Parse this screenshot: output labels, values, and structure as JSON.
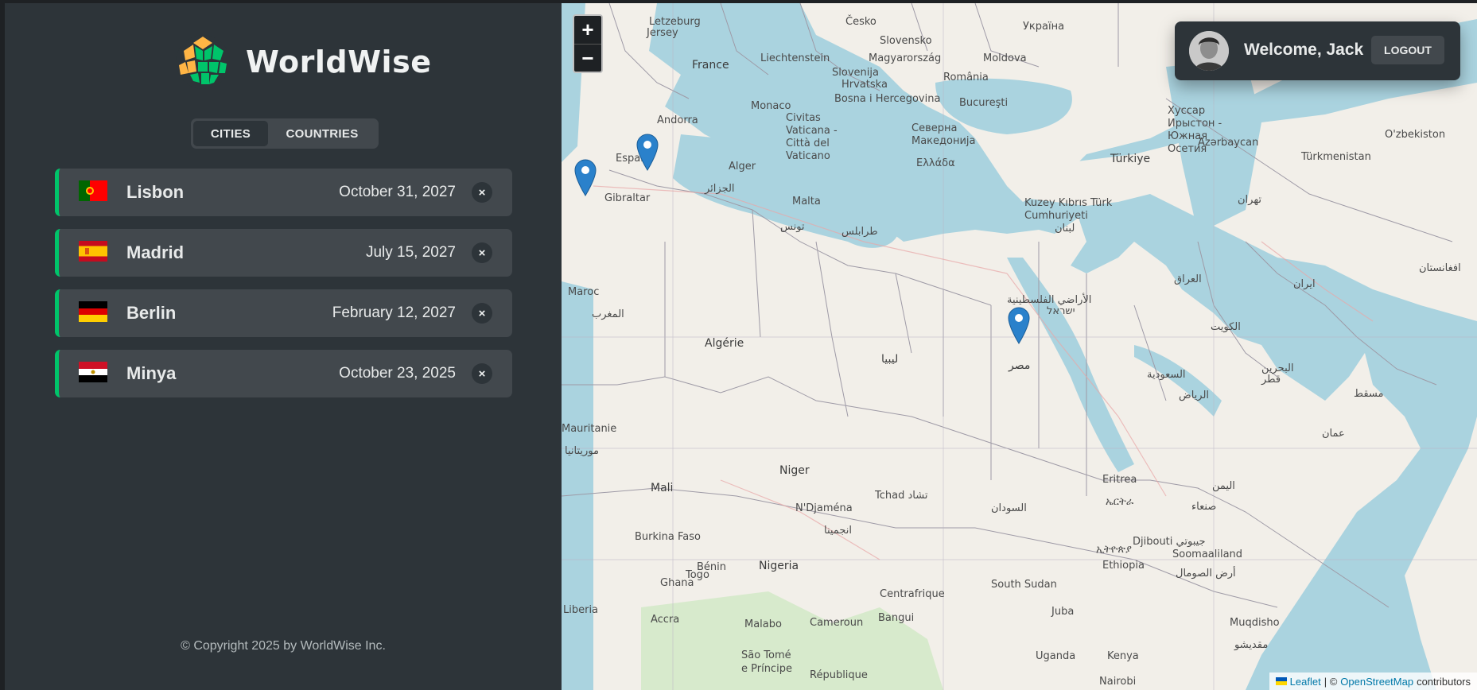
{
  "app": {
    "name": "WorldWise"
  },
  "tabs": [
    {
      "label": "CITIES",
      "active": true
    },
    {
      "label": "COUNTRIES",
      "active": false
    }
  ],
  "cities": [
    {
      "name": "Lisbon",
      "date": "October 31, 2027",
      "flag": "portugal-flag"
    },
    {
      "name": "Madrid",
      "date": "July 15, 2027",
      "flag": "spain-flag"
    },
    {
      "name": "Berlin",
      "date": "February 12, 2027",
      "flag": "germany-flag"
    },
    {
      "name": "Minya",
      "date": "October 23, 2025",
      "flag": "egypt-flag"
    }
  ],
  "delete_label": "×",
  "footer": {
    "text": "© Copyright 2025 by WorldWise Inc."
  },
  "map": {
    "zoom_in": "+",
    "zoom_out": "−",
    "labels": [
      "Letzeburg",
      "Česko",
      "Україна",
      "Jersey",
      "Slovensko",
      "Liechtenstein",
      "Magyarország",
      "Moldova",
      "France",
      "Slovenija",
      "Hrvatska",
      "România",
      "Monaco",
      "Bosna i Hercegovina",
      "Bucureşti",
      "Andorra",
      "Civitas Vaticana - Città del Vaticano",
      "Северна Македонија",
      "Хуссар Ирыстон - Южная Осетия",
      "España",
      "Ελλάδα",
      "Türkiye",
      "Azərbaycan",
      "O'zbekiston",
      "Türkmenistan",
      "Alger",
      "الجزائر",
      "Malta",
      "Gibraltar",
      "Kuzey Kıbrıs Türk Cumhuriyeti",
      "لبنان",
      "تهران",
      "تونس",
      "طرابلس",
      "Maroc",
      "المغرب",
      "الأراضي الفلسطينية",
      "ישראל",
      "العراق",
      "ایران",
      "افغانستان",
      "الكويت",
      "Algérie",
      "ليبيا",
      "مصر",
      "السعودية",
      "الرياض",
      "البحرين",
      "قطر",
      "مسقط",
      "عمان",
      "Mauritanie",
      "موريتانيا",
      "Niger",
      "Mali",
      "Tchad تشاد",
      "N'Djaména",
      "انجمينا",
      "السودان",
      "Eritrea",
      "ኤርትራ",
      "ኢትዮጵያ",
      "Ethiopia",
      "اليمن",
      "صنعاء",
      "Djibouti جيبوتي",
      "Soomaaliland",
      "أرض الصومال",
      "Burkina Faso",
      "Bénin",
      "Togo",
      "Ghana",
      "Nigeria",
      "Centrafrique",
      "Bangui",
      "South Sudan",
      "Juba",
      "Muqdisho",
      "مقديشو",
      "Liberia",
      "Accra",
      "Malabo",
      "Cameroun",
      "São Tomé e Príncipe",
      "République",
      "Uganda",
      "Kenya",
      "Nairobi"
    ]
  },
  "user": {
    "welcome": "Welcome, Jack",
    "logout": "LOGOUT"
  },
  "attribution": {
    "leaflet": "Leaflet",
    "sep": "| ©",
    "osm": "OpenStreetMap",
    "contributors": "contributors"
  },
  "colors": {
    "accent": "#00c46a",
    "sidebar": "#2d3439",
    "panel": "#42484d",
    "marker": "#2a81cb"
  }
}
